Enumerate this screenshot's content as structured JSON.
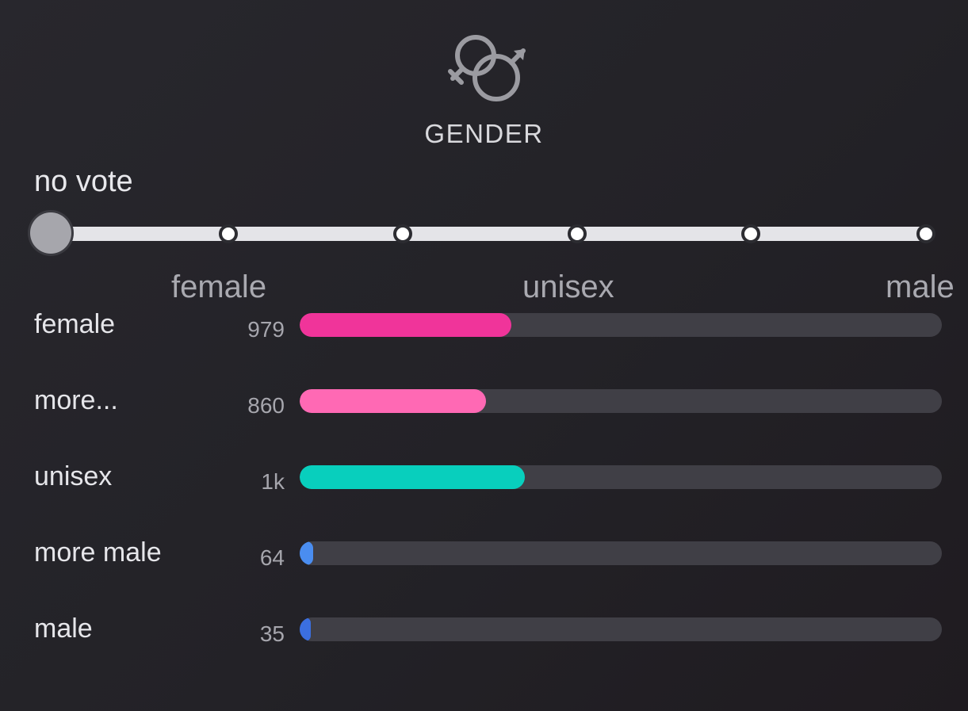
{
  "title": "GENDER",
  "icon": "gender-symbols-icon",
  "vote_status": "no vote",
  "slider": {
    "selected_index": 0,
    "stop_count": 6,
    "scale_labels": [
      "female",
      "unisex",
      "male"
    ]
  },
  "rows": [
    {
      "label": "female",
      "count": "979",
      "fill": 0.33,
      "color": "#f0349a"
    },
    {
      "label": "more...",
      "count": "860",
      "fill": 0.29,
      "color": "#ff69b4"
    },
    {
      "label": "unisex",
      "count": "1k",
      "fill": 0.35,
      "color": "#08cfbd"
    },
    {
      "label": "more male",
      "count": "64",
      "fill": 0.021,
      "color": "#4a8df0"
    },
    {
      "label": "male",
      "count": "35",
      "fill": 0.012,
      "color": "#3b6fe0"
    }
  ],
  "colors": {
    "track": "#e4e4e8",
    "thumb": "#a6a6ac",
    "bar_background": "#403f46"
  }
}
